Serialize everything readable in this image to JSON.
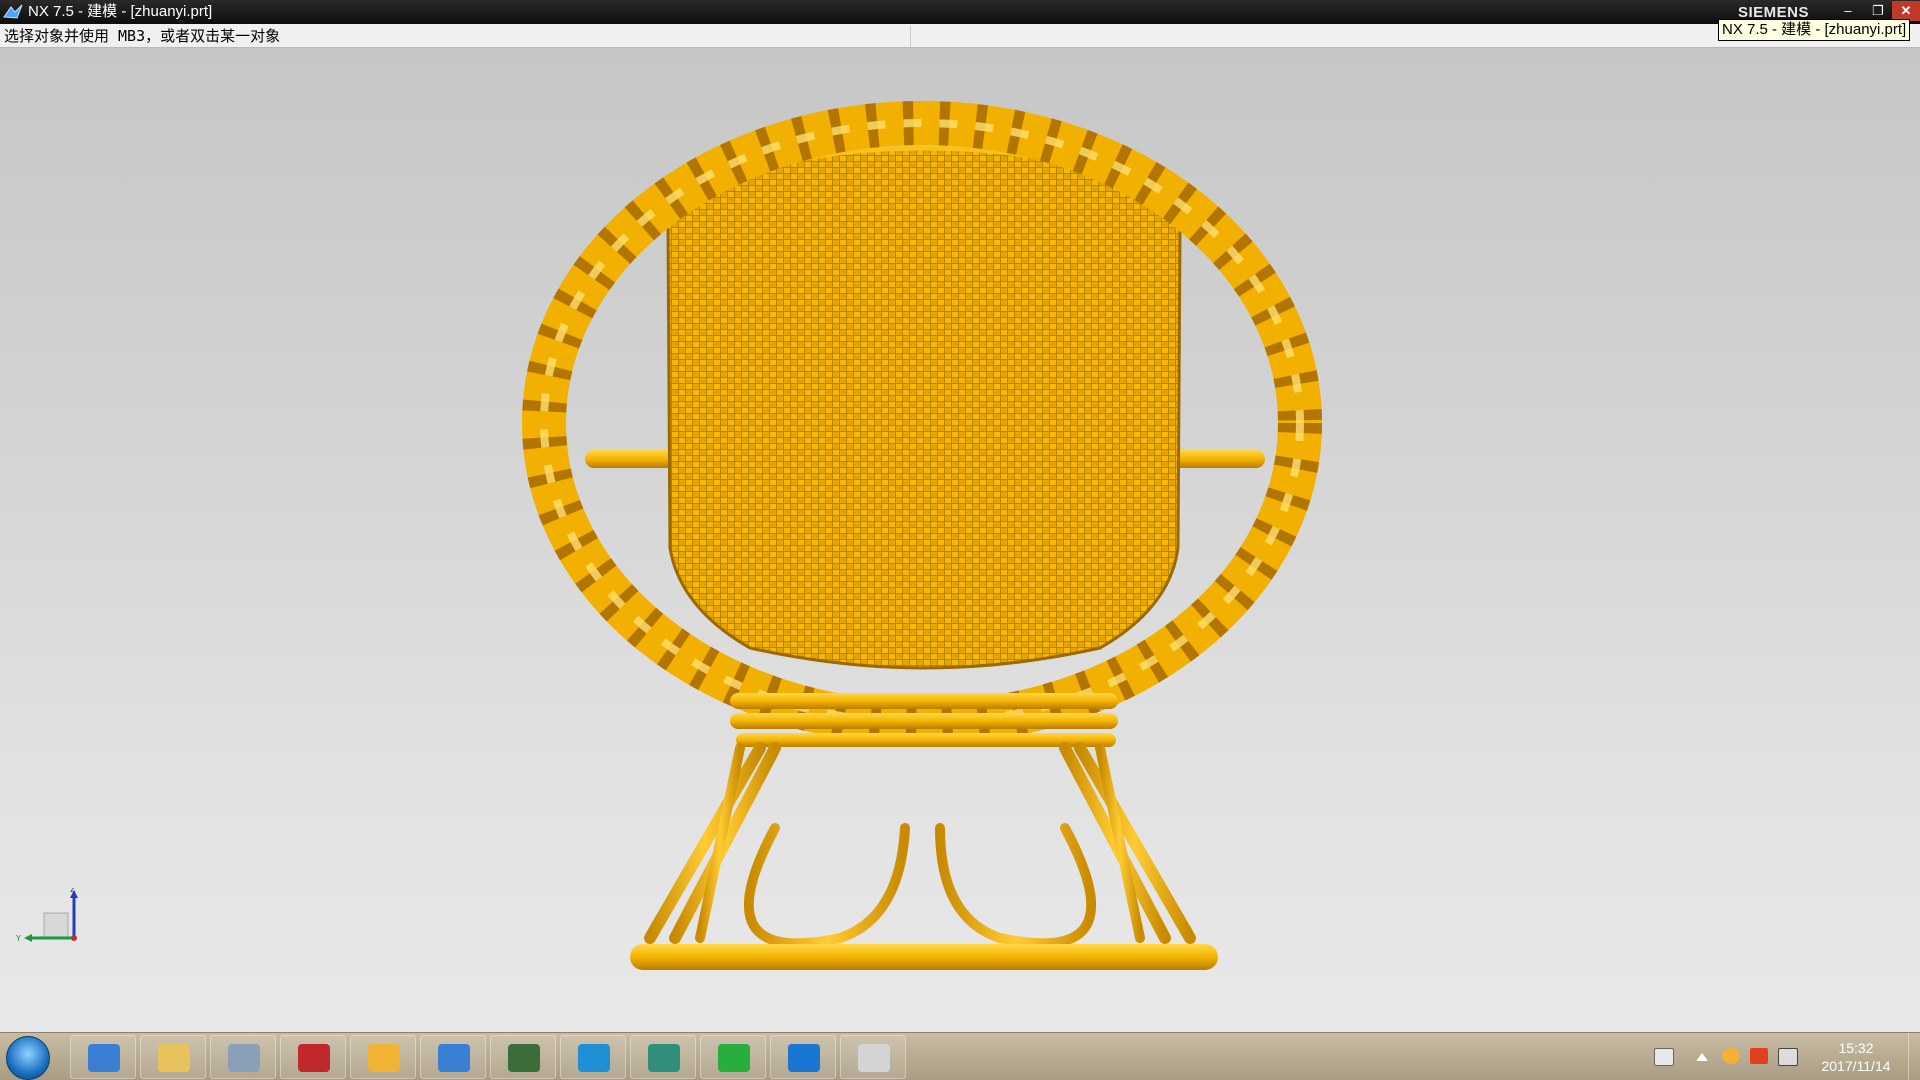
{
  "window": {
    "title": "NX 7.5 - 建模 - [zhuanyi.prt]",
    "brand": "SIEMENS",
    "minimize_glyph": "–",
    "maximize_glyph": "❐",
    "close_glyph": "✕"
  },
  "cue_line": {
    "text": "选择对象并使用 MB3，或者双击某一对象"
  },
  "tooltip": {
    "text": "NX 7.5 - 建模 - [zhuanyi.prt]"
  },
  "triad": {
    "z_label": "Z",
    "y_label": "Y"
  },
  "taskbar": {
    "items": [
      {
        "icon": "nx-icon",
        "color": "#3a7fd4"
      },
      {
        "icon": "folder-icon",
        "color": "#e8c25a"
      },
      {
        "icon": "calculator-icon",
        "color": "#8aa0b8"
      },
      {
        "icon": "autocad-icon",
        "color": "#c0282b"
      },
      {
        "icon": "chat-icon",
        "color": "#f2b233"
      },
      {
        "icon": "nx-active-icon",
        "color": "#3a7fd4"
      },
      {
        "icon": "monitor-icon",
        "color": "#3b6e3b"
      },
      {
        "icon": "qq-icon",
        "color": "#1e90d6"
      },
      {
        "icon": "window-icon",
        "color": "#2f8f7a"
      },
      {
        "icon": "download-icon",
        "color": "#27ae3c"
      },
      {
        "icon": "app-window-icon",
        "color": "#1976d2"
      },
      {
        "icon": "paint-icon",
        "color": "#d4d4d4"
      }
    ]
  },
  "tray": {
    "time": "15:32",
    "date": "2017/11/14"
  },
  "colors": {
    "model": "#f5b400",
    "model_dark": "#c88a00",
    "model_light": "#ffd84a"
  }
}
